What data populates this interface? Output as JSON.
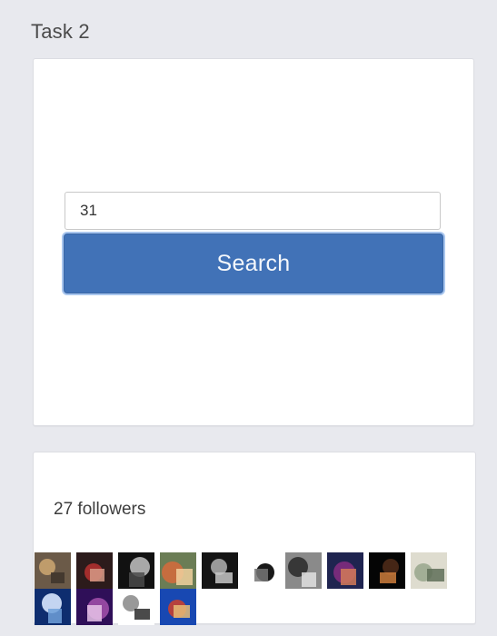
{
  "task": {
    "title": "Task 2"
  },
  "search": {
    "input_value": "31",
    "button_label": "Search"
  },
  "followers": {
    "count_label": "27 followers",
    "avatars": [
      {
        "name": "avatar-1",
        "colors": [
          "#6b5a48",
          "#c9a36f",
          "#3d342c"
        ]
      },
      {
        "name": "avatar-2",
        "colors": [
          "#2c1b1b",
          "#b0302f",
          "#d59a86"
        ]
      },
      {
        "name": "avatar-3",
        "colors": [
          "#111111",
          "#b9b9b9",
          "#4a4a4a"
        ]
      },
      {
        "name": "avatar-4",
        "colors": [
          "#6b7d55",
          "#d06b3d",
          "#f0d09e"
        ]
      },
      {
        "name": "avatar-5",
        "colors": [
          "#141414",
          "#a7a7a7",
          "#c7c7c7"
        ]
      },
      {
        "name": "avatar-6",
        "colors": [
          "#ffffff",
          "#000000",
          "#777777"
        ]
      },
      {
        "name": "avatar-7",
        "colors": [
          "#8a8a8a",
          "#2d2d2d",
          "#e1e1e1"
        ]
      },
      {
        "name": "avatar-8",
        "colors": [
          "#1f2450",
          "#7f2c7e",
          "#d27a58"
        ]
      },
      {
        "name": "avatar-9",
        "colors": [
          "#050505",
          "#4c2a18",
          "#cc7c3c"
        ]
      },
      {
        "name": "avatar-10",
        "colors": [
          "#dedccf",
          "#9ba98f",
          "#5f6e58"
        ]
      },
      {
        "name": "avatar-11",
        "colors": [
          "#0e2d6f",
          "#d8e8ff",
          "#6fa0d9"
        ]
      },
      {
        "name": "avatar-12",
        "colors": [
          "#2f0f58",
          "#9e4ea8",
          "#e6c3e8"
        ]
      },
      {
        "name": "avatar-13",
        "colors": [
          "#ffffff",
          "#8e8e8e",
          "#2a2a2a"
        ]
      },
      {
        "name": "avatar-14",
        "colors": [
          "#1848b2",
          "#c74031",
          "#e6bc75"
        ]
      }
    ]
  }
}
